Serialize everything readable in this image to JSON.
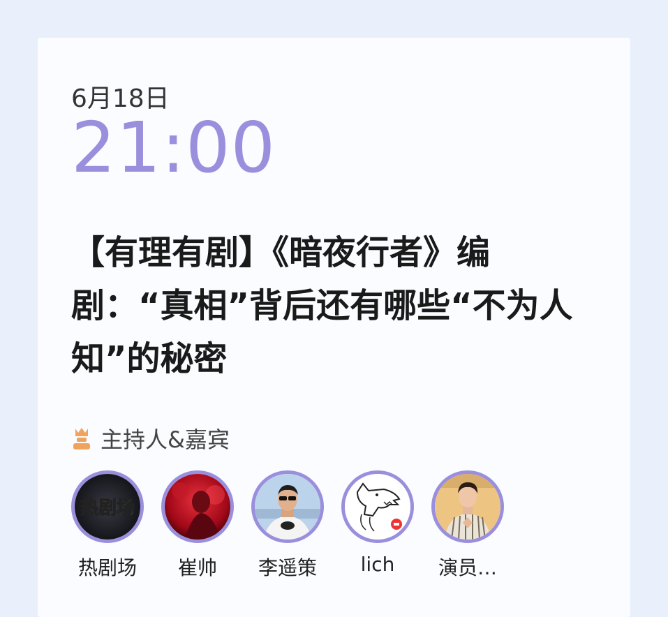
{
  "event": {
    "date": "6月18日",
    "time": "21:00",
    "title": "【有理有剧】《暗夜行者》编剧：“真相”背后还有哪些“不为人知”的秘密"
  },
  "hosts": {
    "label": "主持人&嘉宾",
    "icon": "host-crown-icon",
    "accent_color": "#9a8fdc",
    "guests": [
      {
        "name": "热剧场",
        "avatar_text": "热剧场"
      },
      {
        "name": "崔帅"
      },
      {
        "name": "李遥策"
      },
      {
        "name": "lich"
      },
      {
        "name": "演员…"
      }
    ]
  }
}
